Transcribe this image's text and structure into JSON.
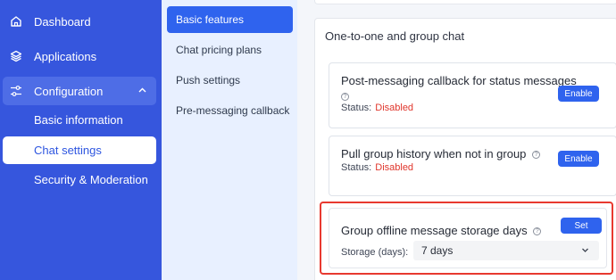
{
  "sidebar": {
    "items": [
      {
        "label": "Dashboard",
        "icon": "home-icon"
      },
      {
        "label": "Applications",
        "icon": "layers-icon"
      },
      {
        "label": "Configuration",
        "icon": "sliders-icon"
      }
    ],
    "sub_items": [
      {
        "label": "Basic information"
      },
      {
        "label": "Chat settings"
      },
      {
        "label": "Security & Moderation"
      }
    ]
  },
  "menu": {
    "items": [
      {
        "label": "Basic features"
      },
      {
        "label": "Chat pricing plans"
      },
      {
        "label": "Push settings"
      },
      {
        "label": "Pre-messaging callback"
      }
    ]
  },
  "main": {
    "section_title": "One-to-one and group chat",
    "cards": [
      {
        "title": "Post-messaging callback for status messages",
        "status_label": "Status:",
        "status_value": "Disabled",
        "button": "Enable"
      },
      {
        "title": "Pull group history when not in group",
        "status_label": "Status:",
        "status_value": "Disabled",
        "button": "Enable"
      }
    ],
    "storage": {
      "title": "Group offline message storage days",
      "button": "Set",
      "label": "Storage (days):",
      "value": "7 days"
    }
  },
  "colors": {
    "sidebar_bg": "#3656dd",
    "primary": "#2f63ee",
    "disabled_text": "#e0362c",
    "highlight_border": "#e8392f"
  }
}
